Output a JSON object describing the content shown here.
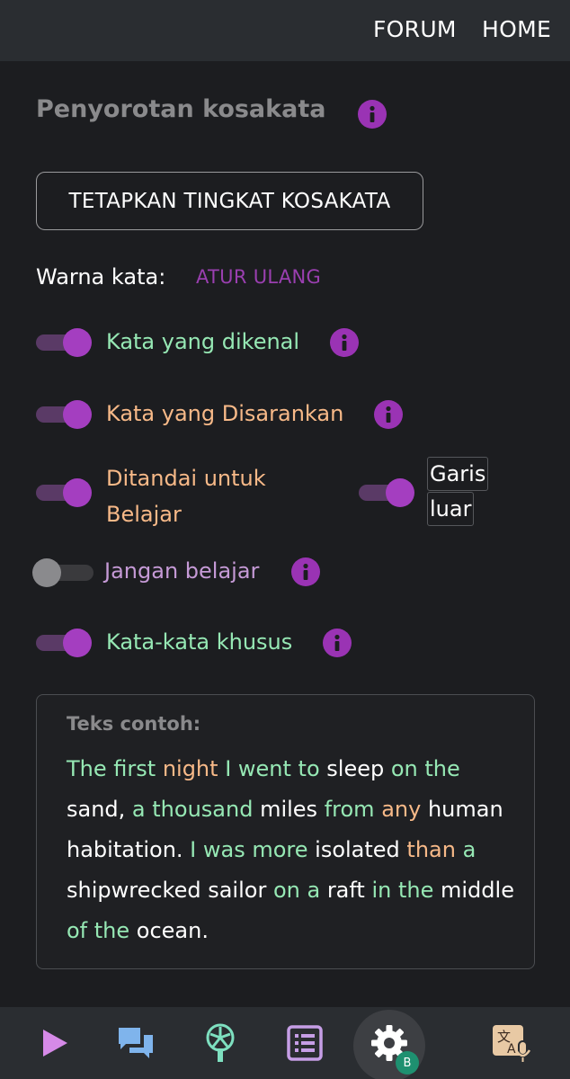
{
  "topbar": {
    "forum": "FORUM",
    "home": "HOME"
  },
  "vocab": {
    "title": "Penyorotan kosakata",
    "set_level_button": "TETAPKAN TINGKAT KOSAKATA",
    "word_color_label": "Warna kata:",
    "reset_link": "ATUR ULANG"
  },
  "options": {
    "known": {
      "label": "Kata yang dikenal",
      "enabled": true,
      "color": "#96e8b4"
    },
    "suggested": {
      "label": "Kata yang Disarankan",
      "enabled": true,
      "color": "#f7b988"
    },
    "marked_line1": "Ditandai untuk",
    "marked_line2": "Belajar",
    "marked": {
      "enabled": true,
      "color": "#f7b988"
    },
    "outline_line1": "Garis",
    "outline_line2": "luar",
    "outline": {
      "enabled": true
    },
    "dont_learn": {
      "label": "Jangan belajar",
      "enabled": false,
      "color": "#c59ad6"
    },
    "special": {
      "label": "Kata-kata khusus",
      "enabled": true,
      "color": "#96e8b4"
    }
  },
  "sample": {
    "title": "Teks contoh:",
    "tokens": [
      {
        "t": "The first",
        "c": "k"
      },
      {
        "t": " ",
        "c": ""
      },
      {
        "t": "night",
        "c": "s"
      },
      {
        "t": " ",
        "c": ""
      },
      {
        "t": "I went to",
        "c": "k"
      },
      {
        "t": " sleep ",
        "c": ""
      },
      {
        "t": "on the",
        "c": "k"
      },
      {
        "t": " sand, ",
        "c": ""
      },
      {
        "t": "a thousand",
        "c": "k"
      },
      {
        "t": " miles ",
        "c": ""
      },
      {
        "t": "from",
        "c": "k"
      },
      {
        "t": " ",
        "c": ""
      },
      {
        "t": "any",
        "c": "s"
      },
      {
        "t": " human habitation. ",
        "c": ""
      },
      {
        "t": "I was more",
        "c": "k"
      },
      {
        "t": " isolated ",
        "c": ""
      },
      {
        "t": "than",
        "c": "s"
      },
      {
        "t": " ",
        "c": ""
      },
      {
        "t": "a",
        "c": "k"
      },
      {
        "t": " shipwrecked sailor ",
        "c": ""
      },
      {
        "t": "on a",
        "c": "k"
      },
      {
        "t": " raft ",
        "c": ""
      },
      {
        "t": "in the",
        "c": "k"
      },
      {
        "t": " middle ",
        "c": ""
      },
      {
        "t": "of the",
        "c": "k"
      },
      {
        "t": " ocean.",
        "c": ""
      }
    ]
  },
  "bottom_nav": {
    "items": [
      "play-icon",
      "chat-icon",
      "pinwheel-icon",
      "list-icon",
      "gear-icon",
      "translate-icon"
    ],
    "badge": "B",
    "active": "gear-icon"
  },
  "colors": {
    "accent": "#9a33b4",
    "known": "#96e8b4",
    "suggested": "#f7b988"
  }
}
